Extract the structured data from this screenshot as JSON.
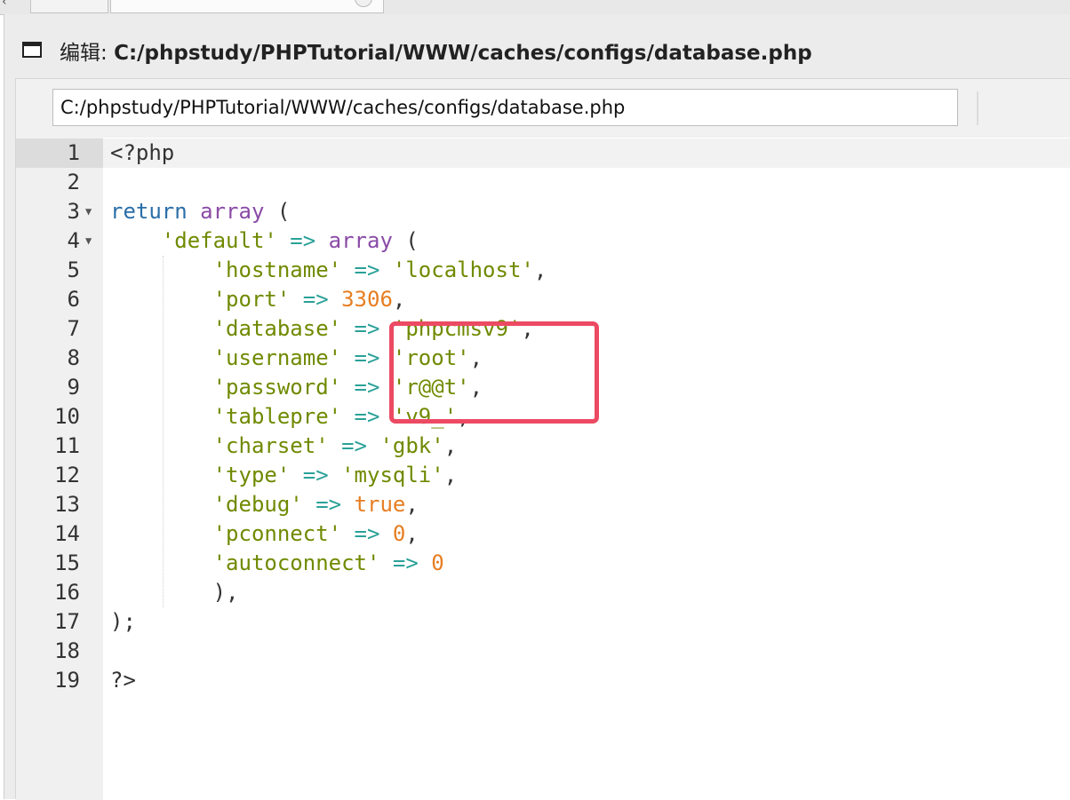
{
  "window": {
    "title_prefix": "编辑: ",
    "title_path": "C:/phpstudy/PHPTutorial/WWW/caches/configs/database.php"
  },
  "pathbar": {
    "value": "C:/phpstudy/PHPTutorial/WWW/caches/configs/database.php"
  },
  "editor": {
    "language": "php",
    "lines": [
      {
        "n": "1",
        "fold": false,
        "tokens": [
          {
            "t": "<?php",
            "c": "punc"
          }
        ]
      },
      {
        "n": "2",
        "fold": false,
        "tokens": []
      },
      {
        "n": "3",
        "fold": true,
        "tokens": [
          {
            "t": "return",
            "c": "kw"
          },
          {
            "t": " ",
            "c": "punc"
          },
          {
            "t": "array",
            "c": "fn"
          },
          {
            "t": " (",
            "c": "punc"
          }
        ]
      },
      {
        "n": "4",
        "fold": true,
        "tokens": [
          {
            "t": "    ",
            "c": "punc"
          },
          {
            "t": "'default'",
            "c": "str"
          },
          {
            "t": " ",
            "c": "punc"
          },
          {
            "t": "=>",
            "c": "op"
          },
          {
            "t": " ",
            "c": "punc"
          },
          {
            "t": "array",
            "c": "fn"
          },
          {
            "t": " (",
            "c": "punc"
          }
        ]
      },
      {
        "n": "5",
        "fold": false,
        "tokens": [
          {
            "t": "        ",
            "c": "punc"
          },
          {
            "t": "'hostname'",
            "c": "str"
          },
          {
            "t": " ",
            "c": "punc"
          },
          {
            "t": "=>",
            "c": "op"
          },
          {
            "t": " ",
            "c": "punc"
          },
          {
            "t": "'localhost'",
            "c": "str"
          },
          {
            "t": ",",
            "c": "punc"
          }
        ]
      },
      {
        "n": "6",
        "fold": false,
        "tokens": [
          {
            "t": "        ",
            "c": "punc"
          },
          {
            "t": "'port'",
            "c": "str"
          },
          {
            "t": " ",
            "c": "punc"
          },
          {
            "t": "=>",
            "c": "op"
          },
          {
            "t": " ",
            "c": "punc"
          },
          {
            "t": "3306",
            "c": "num"
          },
          {
            "t": ",",
            "c": "punc"
          }
        ]
      },
      {
        "n": "7",
        "fold": false,
        "tokens": [
          {
            "t": "        ",
            "c": "punc"
          },
          {
            "t": "'database'",
            "c": "str"
          },
          {
            "t": " ",
            "c": "punc"
          },
          {
            "t": "=>",
            "c": "op"
          },
          {
            "t": " ",
            "c": "punc"
          },
          {
            "t": "'phpcmsv9'",
            "c": "str"
          },
          {
            "t": ",",
            "c": "punc"
          }
        ]
      },
      {
        "n": "8",
        "fold": false,
        "tokens": [
          {
            "t": "        ",
            "c": "punc"
          },
          {
            "t": "'username'",
            "c": "str"
          },
          {
            "t": " ",
            "c": "punc"
          },
          {
            "t": "=>",
            "c": "op"
          },
          {
            "t": " ",
            "c": "punc"
          },
          {
            "t": "'root'",
            "c": "str"
          },
          {
            "t": ",",
            "c": "punc"
          }
        ]
      },
      {
        "n": "9",
        "fold": false,
        "tokens": [
          {
            "t": "        ",
            "c": "punc"
          },
          {
            "t": "'password'",
            "c": "str"
          },
          {
            "t": " ",
            "c": "punc"
          },
          {
            "t": "=>",
            "c": "op"
          },
          {
            "t": " ",
            "c": "punc"
          },
          {
            "t": "'r@@t'",
            "c": "str"
          },
          {
            "t": ",",
            "c": "punc"
          }
        ]
      },
      {
        "n": "10",
        "fold": false,
        "tokens": [
          {
            "t": "        ",
            "c": "punc"
          },
          {
            "t": "'tablepre'",
            "c": "str"
          },
          {
            "t": " ",
            "c": "punc"
          },
          {
            "t": "=>",
            "c": "op"
          },
          {
            "t": " ",
            "c": "punc"
          },
          {
            "t": "'v9_'",
            "c": "str"
          },
          {
            "t": ",",
            "c": "punc"
          }
        ]
      },
      {
        "n": "11",
        "fold": false,
        "tokens": [
          {
            "t": "        ",
            "c": "punc"
          },
          {
            "t": "'charset'",
            "c": "str"
          },
          {
            "t": " ",
            "c": "punc"
          },
          {
            "t": "=>",
            "c": "op"
          },
          {
            "t": " ",
            "c": "punc"
          },
          {
            "t": "'gbk'",
            "c": "str"
          },
          {
            "t": ",",
            "c": "punc"
          }
        ]
      },
      {
        "n": "12",
        "fold": false,
        "tokens": [
          {
            "t": "        ",
            "c": "punc"
          },
          {
            "t": "'type'",
            "c": "str"
          },
          {
            "t": " ",
            "c": "punc"
          },
          {
            "t": "=>",
            "c": "op"
          },
          {
            "t": " ",
            "c": "punc"
          },
          {
            "t": "'mysqli'",
            "c": "str"
          },
          {
            "t": ",",
            "c": "punc"
          }
        ]
      },
      {
        "n": "13",
        "fold": false,
        "tokens": [
          {
            "t": "        ",
            "c": "punc"
          },
          {
            "t": "'debug'",
            "c": "str"
          },
          {
            "t": " ",
            "c": "punc"
          },
          {
            "t": "=>",
            "c": "op"
          },
          {
            "t": " ",
            "c": "punc"
          },
          {
            "t": "true",
            "c": "const"
          },
          {
            "t": ",",
            "c": "punc"
          }
        ]
      },
      {
        "n": "14",
        "fold": false,
        "tokens": [
          {
            "t": "        ",
            "c": "punc"
          },
          {
            "t": "'pconnect'",
            "c": "str"
          },
          {
            "t": " ",
            "c": "punc"
          },
          {
            "t": "=>",
            "c": "op"
          },
          {
            "t": " ",
            "c": "punc"
          },
          {
            "t": "0",
            "c": "num"
          },
          {
            "t": ",",
            "c": "punc"
          }
        ]
      },
      {
        "n": "15",
        "fold": false,
        "tokens": [
          {
            "t": "        ",
            "c": "punc"
          },
          {
            "t": "'autoconnect'",
            "c": "str"
          },
          {
            "t": " ",
            "c": "punc"
          },
          {
            "t": "=>",
            "c": "op"
          },
          {
            "t": " ",
            "c": "punc"
          },
          {
            "t": "0",
            "c": "num"
          }
        ]
      },
      {
        "n": "16",
        "fold": false,
        "tokens": [
          {
            "t": "        ",
            "c": "punc"
          },
          {
            "t": "),",
            "c": "punc"
          }
        ]
      },
      {
        "n": "17",
        "fold": false,
        "tokens": [
          {
            "t": ");",
            "c": "punc"
          }
        ]
      },
      {
        "n": "18",
        "fold": false,
        "tokens": []
      },
      {
        "n": "19",
        "fold": false,
        "tokens": [
          {
            "t": "?>",
            "c": "punc"
          }
        ]
      }
    ]
  },
  "colors": {
    "keyword": "#2a6ea8",
    "function": "#8a4ba6",
    "string": "#6f8a00",
    "operator": "#2aa198",
    "number": "#e67e22",
    "annotation_box": "#ec4a63"
  },
  "icons": {
    "window": "window-icon",
    "fold": "fold-arrow-icon",
    "tab_close": "close-icon"
  }
}
